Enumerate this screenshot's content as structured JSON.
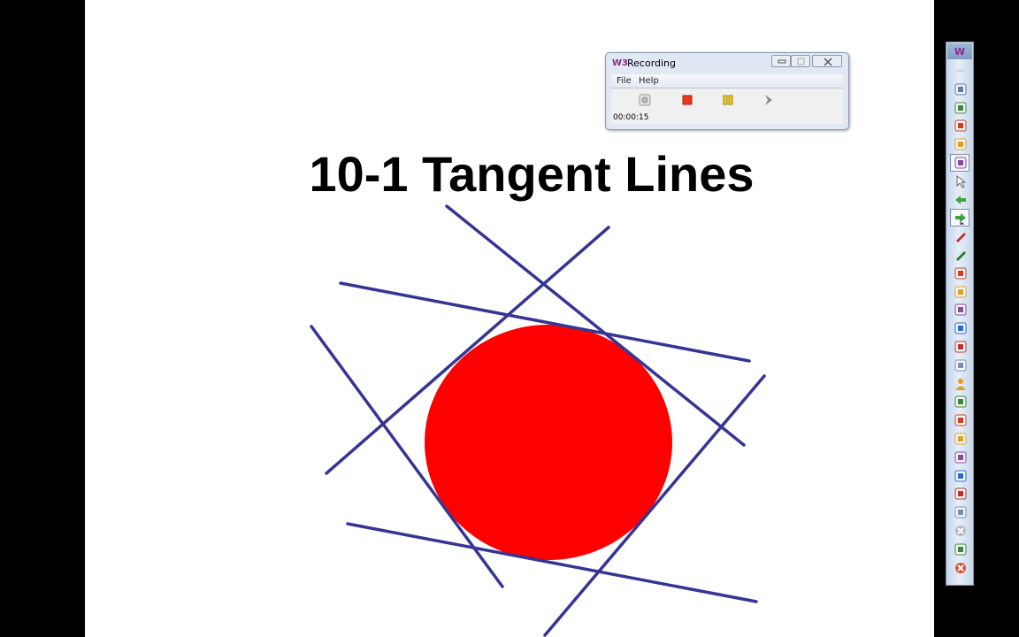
{
  "slide": {
    "title": "10-1 Tangent Lines"
  },
  "colors": {
    "circle": "#ff0000",
    "tangent_lines": "#353595",
    "background": "#ffffff",
    "letterbox": "#000000"
  },
  "recording_window": {
    "logo": "W3",
    "title": "Recording",
    "menu": [
      "File",
      "Help"
    ],
    "controls": [
      "record-icon",
      "stop-icon",
      "pause-icon",
      "play-icon"
    ],
    "elapsed_time": "00:00:15"
  },
  "toolbar": {
    "logo": "W",
    "icons": [
      "minimize-icon",
      "scroll-up-icon",
      "mouse-icon",
      "copy-page-icon",
      "screen-capture-icon",
      "multi-select-icon",
      "pointer-icon",
      "back-arrow-icon",
      "forward-arrow-icon",
      "pen-icon",
      "highlighter-icon",
      "double-pen-icon",
      "eraser-tool-icon",
      "text-tool-icon",
      "math-tool-icon",
      "shape-tool-icon",
      "flag-icon",
      "user-icon",
      "slide-icon",
      "word-doc-icon",
      "excel-icon",
      "layers-icon",
      "duplicate-icon",
      "stamp-icon",
      "email-icon",
      "clear-icon",
      "erase-all-icon",
      "exit-icon"
    ]
  }
}
